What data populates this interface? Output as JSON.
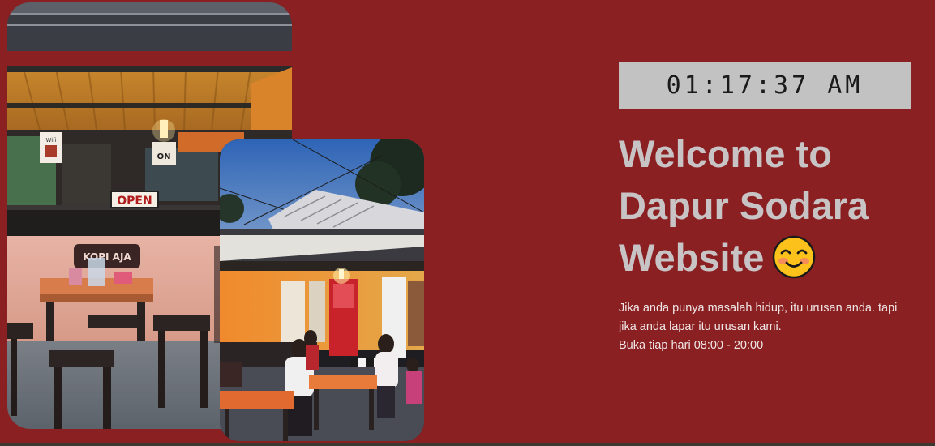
{
  "clock": {
    "time": "01:17:37 AM"
  },
  "hero": {
    "title_line1": "Welcome to",
    "title_line2": "Dapur Sodara",
    "title_line3": "Website",
    "emoji": "smiling-face-icon"
  },
  "description": {
    "line1": "Jika anda punya masalah hidup, itu urusan anda. tapi",
    "line2": "jika anda lapar itu urusan kami.",
    "line3": "Buka tiap hari 08:00 - 20:00"
  },
  "photos": {
    "back_sign_open": "OPEN",
    "back_sign_kopi": "KOPI AJA",
    "back_sign_wifi": "Wifi",
    "back_sign_on": "ON"
  }
}
